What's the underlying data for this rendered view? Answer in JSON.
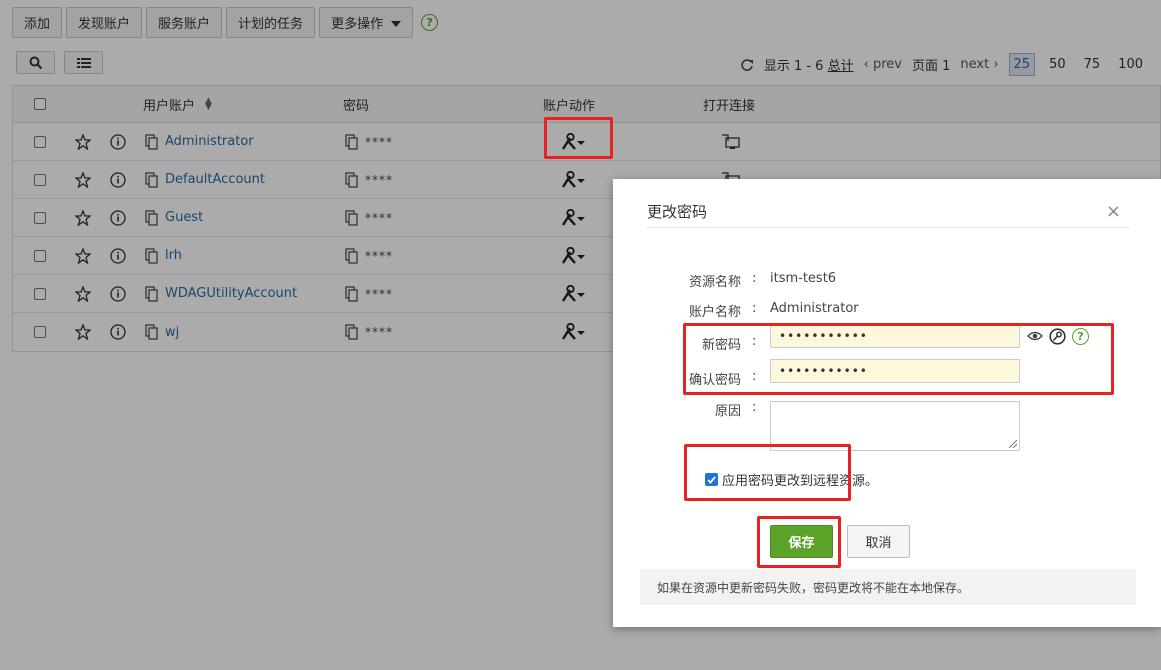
{
  "toolbar": {
    "add": "添加",
    "discover": "发现账户",
    "service": "服务账户",
    "scheduled": "计划的任务",
    "more": "更多操作",
    "help": "?"
  },
  "pager": {
    "showing_prefix": "显示 1 - 6 ",
    "total": "总计",
    "prev": "prev",
    "page": "页面 1",
    "next": "next",
    "sizes": [
      "25",
      "50",
      "75",
      "100"
    ],
    "active_size": "25"
  },
  "table": {
    "headers": {
      "user": "用户账户",
      "password": "密码",
      "action": "账户动作",
      "connect": "打开连接"
    },
    "rows": [
      {
        "name": "Administrator",
        "password": "****"
      },
      {
        "name": "DefaultAccount",
        "password": "****"
      },
      {
        "name": "Guest",
        "password": "****"
      },
      {
        "name": "lrh",
        "password": "****"
      },
      {
        "name": "WDAGUtilityAccount",
        "password": "****"
      },
      {
        "name": "wj",
        "password": "****"
      }
    ]
  },
  "dialog": {
    "title": "更改密码",
    "close": "×",
    "resource_label": "资源名称",
    "resource_value": "itsm-test6",
    "account_label": "账户名称",
    "account_value": "Administrator",
    "new_pw_label": "新密码",
    "new_pw_value": "•••••••••••",
    "confirm_label": "确认密码",
    "confirm_value": "•••••••••••",
    "reason_label": "原因",
    "colon": ":",
    "apply_label": "应用密码更改到远程资源。",
    "apply_checked": true,
    "save": "保存",
    "cancel": "取消",
    "note": "如果在资源中更新密码失败，密码更改将不能在本地保存。"
  },
  "colors": {
    "accent_green": "#5aa228",
    "link_blue": "#2a6aa0",
    "highlight_red": "#e62222"
  }
}
